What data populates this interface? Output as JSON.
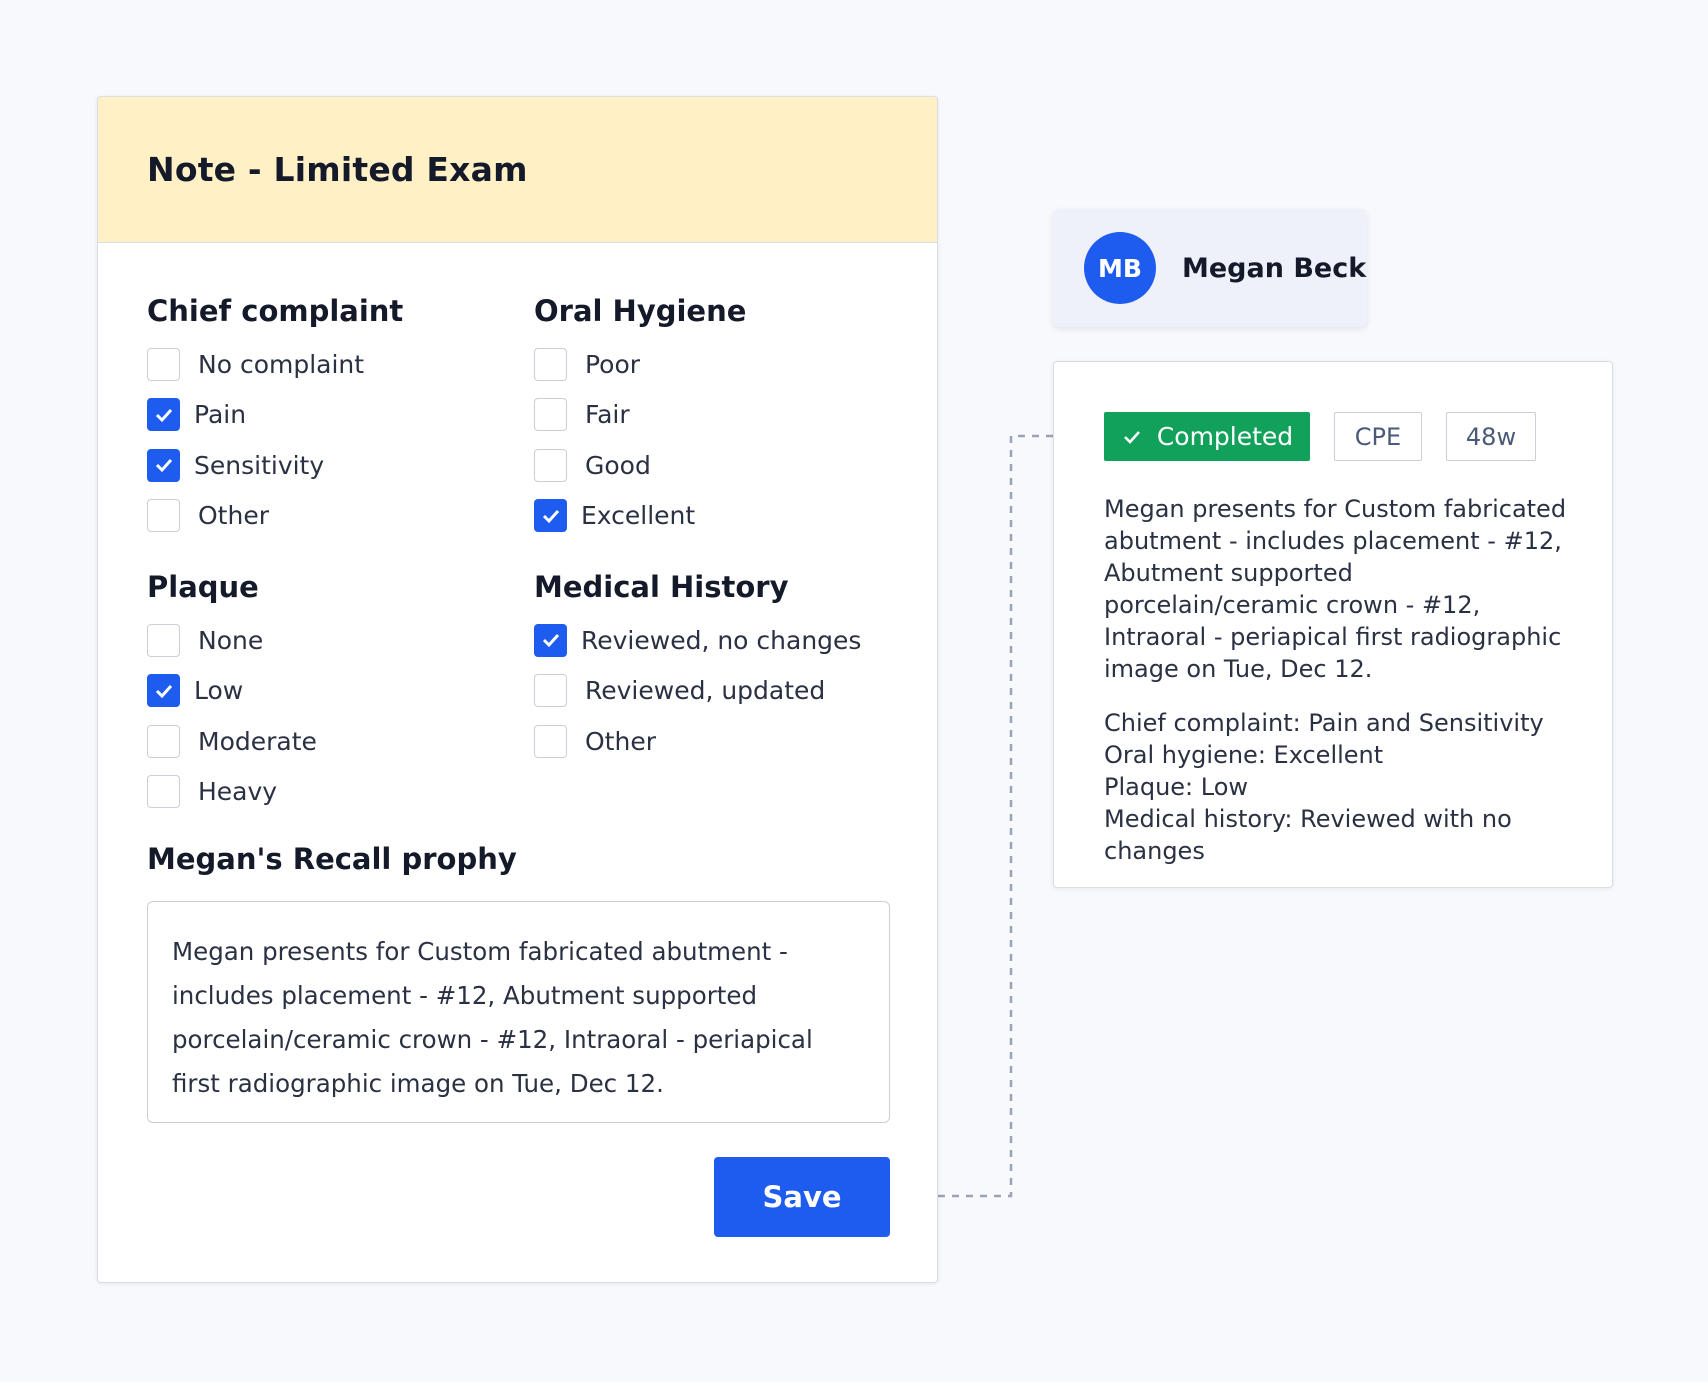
{
  "note": {
    "title": "Note - Limited Exam",
    "sections": {
      "chief_complaint": {
        "title": "Chief complaint",
        "options": [
          {
            "label": "No complaint",
            "checked": false
          },
          {
            "label": "Pain",
            "checked": true
          },
          {
            "label": "Sensitivity",
            "checked": true
          },
          {
            "label": "Other",
            "checked": false
          }
        ]
      },
      "oral_hygiene": {
        "title": "Oral Hygiene",
        "options": [
          {
            "label": "Poor",
            "checked": false
          },
          {
            "label": "Fair",
            "checked": false
          },
          {
            "label": "Good",
            "checked": false
          },
          {
            "label": "Excellent",
            "checked": true
          }
        ]
      },
      "plaque": {
        "title": "Plaque",
        "options": [
          {
            "label": "None",
            "checked": false
          },
          {
            "label": "Low",
            "checked": true
          },
          {
            "label": "Moderate",
            "checked": false
          },
          {
            "label": "Heavy",
            "checked": false
          }
        ]
      },
      "medical_history": {
        "title": "Medical History",
        "options": [
          {
            "label": "Reviewed, no changes",
            "checked": true
          },
          {
            "label": "Reviewed, updated",
            "checked": false
          },
          {
            "label": "Other",
            "checked": false
          }
        ]
      }
    },
    "prophy": {
      "title": "Megan's Recall prophy",
      "text": "Megan presents for Custom fabricated abutment - includes placement - #12, Abutment supported porcelain/ceramic crown - #12, Intraoral - periapical first radiographic image on Tue, Dec 12."
    },
    "save_label": "Save"
  },
  "patient": {
    "initials": "MB",
    "name": "Megan Beck"
  },
  "summary": {
    "status_label": "Completed",
    "tags": [
      "CPE",
      "48w"
    ],
    "description": "Megan presents for Custom fabricated abutment - includes placement - #12, Abutment supported porcelain/ceramic crown - #12, Intraoral - periapical first radiographic image on Tue, Dec 12.",
    "details": [
      "Chief complaint: Pain and Sensitivity",
      "Oral hygiene: Excellent",
      "Plaque: Low",
      "Medical history: Reviewed with no changes"
    ]
  },
  "colors": {
    "accent": "#1e5cf0",
    "success": "#12a15a",
    "header_bg": "#fff0c5"
  }
}
